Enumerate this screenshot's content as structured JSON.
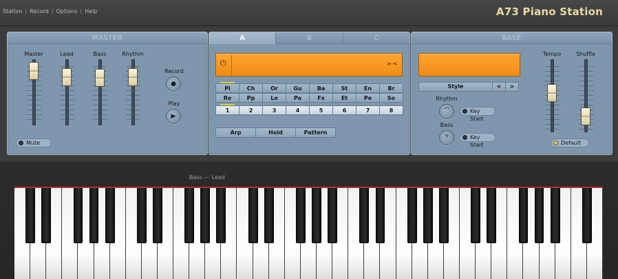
{
  "app": {
    "title": "A73 Piano Station"
  },
  "menu": [
    "Station",
    "Record",
    "Options",
    "Help"
  ],
  "master": {
    "title": "MASTER",
    "sliders": [
      {
        "label": "Master",
        "level": 0.94
      },
      {
        "label": "Lead",
        "level": 0.82
      },
      {
        "label": "Bass",
        "level": 0.8
      },
      {
        "label": "Rhythm",
        "level": 0.82
      }
    ],
    "record_label": "Record",
    "play_label": "Play",
    "mute_label": "Mute"
  },
  "sound": {
    "tabs": [
      "A",
      "B",
      "C"
    ],
    "active_tab": "A",
    "display_text": "",
    "voices": [
      "Pi",
      "Ch",
      "Or",
      "Gu",
      "Ba",
      "St",
      "En",
      "Br",
      "Re",
      "Pp",
      "Le",
      "Pa",
      "Fx",
      "Et",
      "Pe",
      "So"
    ],
    "selected_voice": "Pi",
    "numbers": [
      "1",
      "2",
      "3",
      "4",
      "5",
      "6",
      "7",
      "8"
    ],
    "selected_number": "1",
    "modes": [
      "Arp",
      "Hold",
      "Pattern"
    ]
  },
  "base": {
    "title": "BASE",
    "display_text": "",
    "style_label": "Style",
    "prev": "<",
    "next": ">",
    "rhythm_label": "Rhythm",
    "bass_label": "Bass",
    "keystart_label": "Key Start",
    "tempo_label": "Tempo",
    "tempo_level": 0.55,
    "shuffle_label": "Shuffle",
    "shuffle_level": 0.13,
    "default_label": "Default"
  },
  "keyboard": {
    "split_label": "Bass --- Lead",
    "white_keys": 37,
    "colors": {
      "accent": "#b33030",
      "lcd": "#f5961e",
      "panel": "#7f97ad",
      "title": "#e8d9a2"
    }
  }
}
